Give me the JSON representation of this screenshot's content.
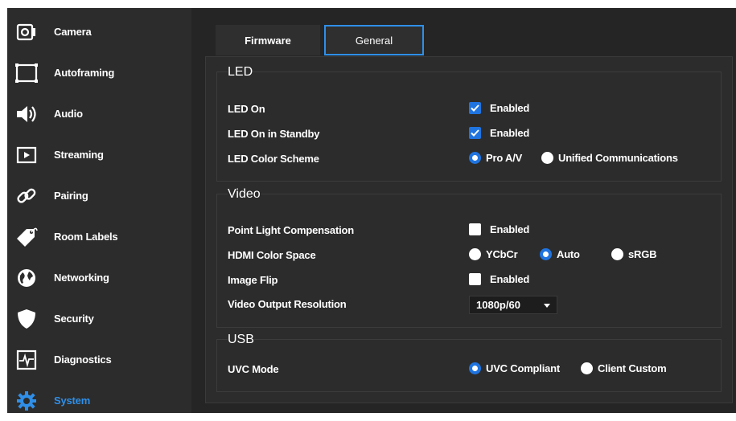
{
  "sidebar": {
    "items": [
      {
        "label": "Camera",
        "icon": "camera-icon"
      },
      {
        "label": "Autoframing",
        "icon": "autoframing-icon"
      },
      {
        "label": "Audio",
        "icon": "speaker-icon"
      },
      {
        "label": "Streaming",
        "icon": "play-icon"
      },
      {
        "label": "Pairing",
        "icon": "link-icon"
      },
      {
        "label": "Room Labels",
        "icon": "tag-icon"
      },
      {
        "label": "Networking",
        "icon": "globe-icon"
      },
      {
        "label": "Security",
        "icon": "shield-icon"
      },
      {
        "label": "Diagnostics",
        "icon": "pulse-icon"
      },
      {
        "label": "System",
        "icon": "gear-icon",
        "active": true
      }
    ]
  },
  "tabs": {
    "firmware": "Firmware",
    "general": "General",
    "active": "General"
  },
  "colors": {
    "accent": "#1f74e0",
    "active_text": "#2f8fe8",
    "background": "#252525",
    "panel": "#2c2c2c"
  },
  "sections": {
    "led": {
      "title": "LED",
      "led_on": {
        "label": "LED On",
        "checkbox_label": "Enabled",
        "checked": true
      },
      "led_standby": {
        "label": "LED On in Standby",
        "checkbox_label": "Enabled",
        "checked": true
      },
      "color_scheme": {
        "label": "LED Color Scheme",
        "options": [
          "Pro A/V",
          "Unified Communications"
        ],
        "selected": "Pro A/V"
      }
    },
    "video": {
      "title": "Video",
      "plc": {
        "label": "Point Light Compensation",
        "checkbox_label": "Enabled",
        "checked": false
      },
      "hdmi": {
        "label": "HDMI Color Space",
        "options": [
          "YCbCr",
          "Auto",
          "sRGB"
        ],
        "selected": "Auto"
      },
      "flip": {
        "label": "Image Flip",
        "checkbox_label": "Enabled",
        "checked": false
      },
      "resolution": {
        "label": "Video Output Resolution",
        "value": "1080p/60"
      }
    },
    "usb": {
      "title": "USB",
      "uvc": {
        "label": "UVC Mode",
        "options": [
          "UVC Compliant",
          "Client Custom"
        ],
        "selected": "UVC Compliant"
      }
    }
  }
}
